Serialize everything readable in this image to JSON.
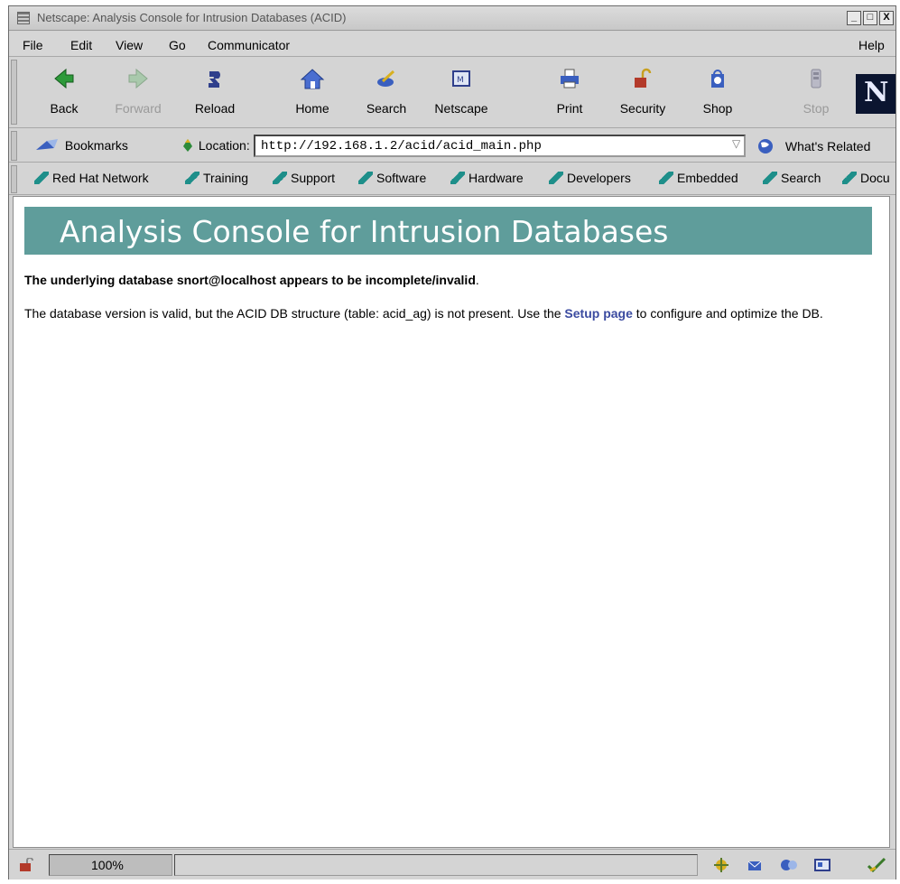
{
  "window": {
    "title": "Netscape: Analysis Console for Intrusion Databases (ACID)",
    "controls": {
      "minimize": "_",
      "maximize": "□",
      "close": "X"
    }
  },
  "menubar": [
    "File",
    "Edit",
    "View",
    "Go",
    "Communicator",
    "Help"
  ],
  "toolbar": [
    {
      "label": "Back",
      "icon": "back-arrow-icon",
      "enabled": true
    },
    {
      "label": "Forward",
      "icon": "forward-arrow-icon",
      "enabled": false
    },
    {
      "label": "Reload",
      "icon": "reload-icon",
      "enabled": true
    },
    {
      "label": "Home",
      "icon": "home-icon",
      "enabled": true
    },
    {
      "label": "Search",
      "icon": "search-icon",
      "enabled": true
    },
    {
      "label": "Netscape",
      "icon": "netscape-icon",
      "enabled": true
    },
    {
      "label": "Print",
      "icon": "print-icon",
      "enabled": true
    },
    {
      "label": "Security",
      "icon": "lock-icon",
      "enabled": true
    },
    {
      "label": "Shop",
      "icon": "shop-icon",
      "enabled": true
    },
    {
      "label": "Stop",
      "icon": "stop-icon",
      "enabled": false
    }
  ],
  "logo": "N",
  "location_bar": {
    "bookmarks_label": "Bookmarks",
    "location_label": "Location:",
    "url": "http://192.168.1.2/acid/acid_main.php",
    "whats_related_label": "What's Related"
  },
  "personal_toolbar": [
    "Red Hat Network",
    "Training",
    "Support",
    "Software",
    "Hardware",
    "Developers",
    "Embedded",
    "Search",
    "Docu"
  ],
  "page": {
    "banner_title": "Analysis Console for Intrusion Databases",
    "error_message": "The underlying database snort@localhost appears to be incomplete/invalid",
    "error_period": ".",
    "info_before_link": "The database version is valid, but the ACID DB structure (table: acid_ag) is not present. Use the ",
    "setup_link": "Setup page",
    "info_after_link": " to configure and optimize the DB."
  },
  "status_bar": {
    "zoom": "100%"
  },
  "colors": {
    "banner": "#5f9d9b",
    "link": "#3b4ba0",
    "chrome": "#d4d4d4"
  }
}
